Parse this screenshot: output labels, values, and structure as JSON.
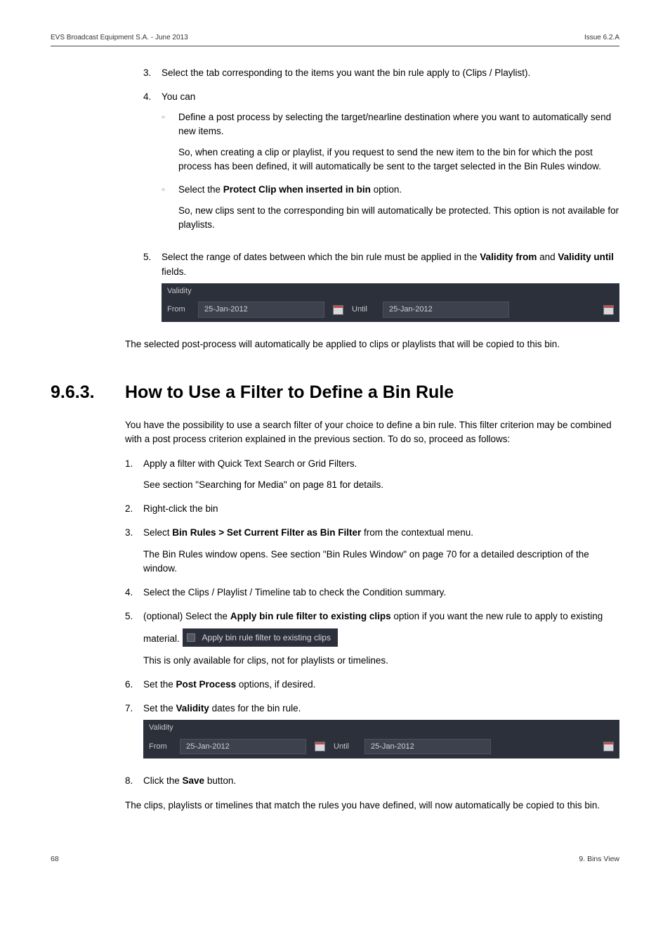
{
  "header": {
    "left": "EVS Broadcast Equipment S.A.  -  June 2013",
    "right": "Issue 6.2.A"
  },
  "first_list": {
    "i3": {
      "num": "3.",
      "text_a": "Select the tab corresponding to the items you want the bin rule apply to (Clips / Playlist)."
    },
    "i4": {
      "num": "4.",
      "text_a": "You can",
      "sub1_a": "Define a post process by selecting the target/nearline destination where you want to automatically send new items.",
      "sub1_b": "So, when creating a clip or playlist, if you request to send the new item to the bin for which the post process has been defined, it will automatically be sent to the target selected in the Bin Rules window.",
      "sub2_a_pre": "Select the ",
      "sub2_a_bold": "Protect Clip when inserted in bin",
      "sub2_a_post": " option.",
      "sub2_b": "So, new clips sent to the corresponding bin will automatically be protected. This option is not available for playlists."
    },
    "i5": {
      "num": "5.",
      "pre": "Select the range of dates between which the bin rule must be applied in the ",
      "b1": "Validity from",
      "mid": " and ",
      "b2": "Validity until",
      "post": " fields."
    }
  },
  "validity1": {
    "title": "Validity",
    "from_label": "From",
    "from_value": "25-Jan-2012",
    "until_label": "Until",
    "until_value": "25-Jan-2012"
  },
  "after1": "The selected post-process will automatically be applied to clips or playlists that will be copied to this bin.",
  "h2": {
    "num": "9.6.3.",
    "title": "How to Use a Filter to Define a Bin Rule"
  },
  "intro": "You have the possibility to use a search filter of your choice to define a bin rule. This filter criterion may be combined with a post process criterion explained in the previous section. To do so, proceed as follows:",
  "second_list": {
    "i1": {
      "num": "1.",
      "text": "Apply a filter with Quick Text Search or Grid Filters.",
      "sub": "See section \"Searching for Media\" on page 81 for details."
    },
    "i2": {
      "num": "2.",
      "text": "Right-click the bin"
    },
    "i3": {
      "num": "3.",
      "pre": "Select ",
      "bold": "Bin Rules > Set Current Filter as Bin Filter",
      "post": " from the contextual menu.",
      "sub": "The Bin Rules window opens. See section \"Bin Rules Window\" on page 70 for a detailed description of the window."
    },
    "i4": {
      "num": "4.",
      "text": "Select the Clips / Playlist / Timeline tab to check the Condition summary."
    },
    "i5": {
      "num": "5.",
      "pre": "(optional) Select the ",
      "bold": "Apply bin rule filter to existing clips",
      "post": " option if you want the new rule to apply to existing material."
    },
    "apply_box": "Apply bin rule filter to existing clips",
    "i5_after": "This is only available for clips, not for playlists or timelines.",
    "i6": {
      "num": "6.",
      "pre": "Set the ",
      "bold": "Post Process",
      "post": " options, if desired."
    },
    "i7": {
      "num": "7.",
      "pre": "Set the ",
      "bold": "Validity",
      "post": " dates for the bin rule."
    },
    "i8": {
      "num": "8.",
      "pre": "Click the ",
      "bold": "Save",
      "post": " button."
    }
  },
  "validity2": {
    "title": "Validity",
    "from_label": "From",
    "from_value": "25-Jan-2012",
    "until_label": "Until",
    "until_value": "25-Jan-2012"
  },
  "after2": "The clips, playlists or timelines that match the rules you have defined, will now automatically be copied to this bin.",
  "footer": {
    "left": "68",
    "right": "9. Bins View"
  }
}
